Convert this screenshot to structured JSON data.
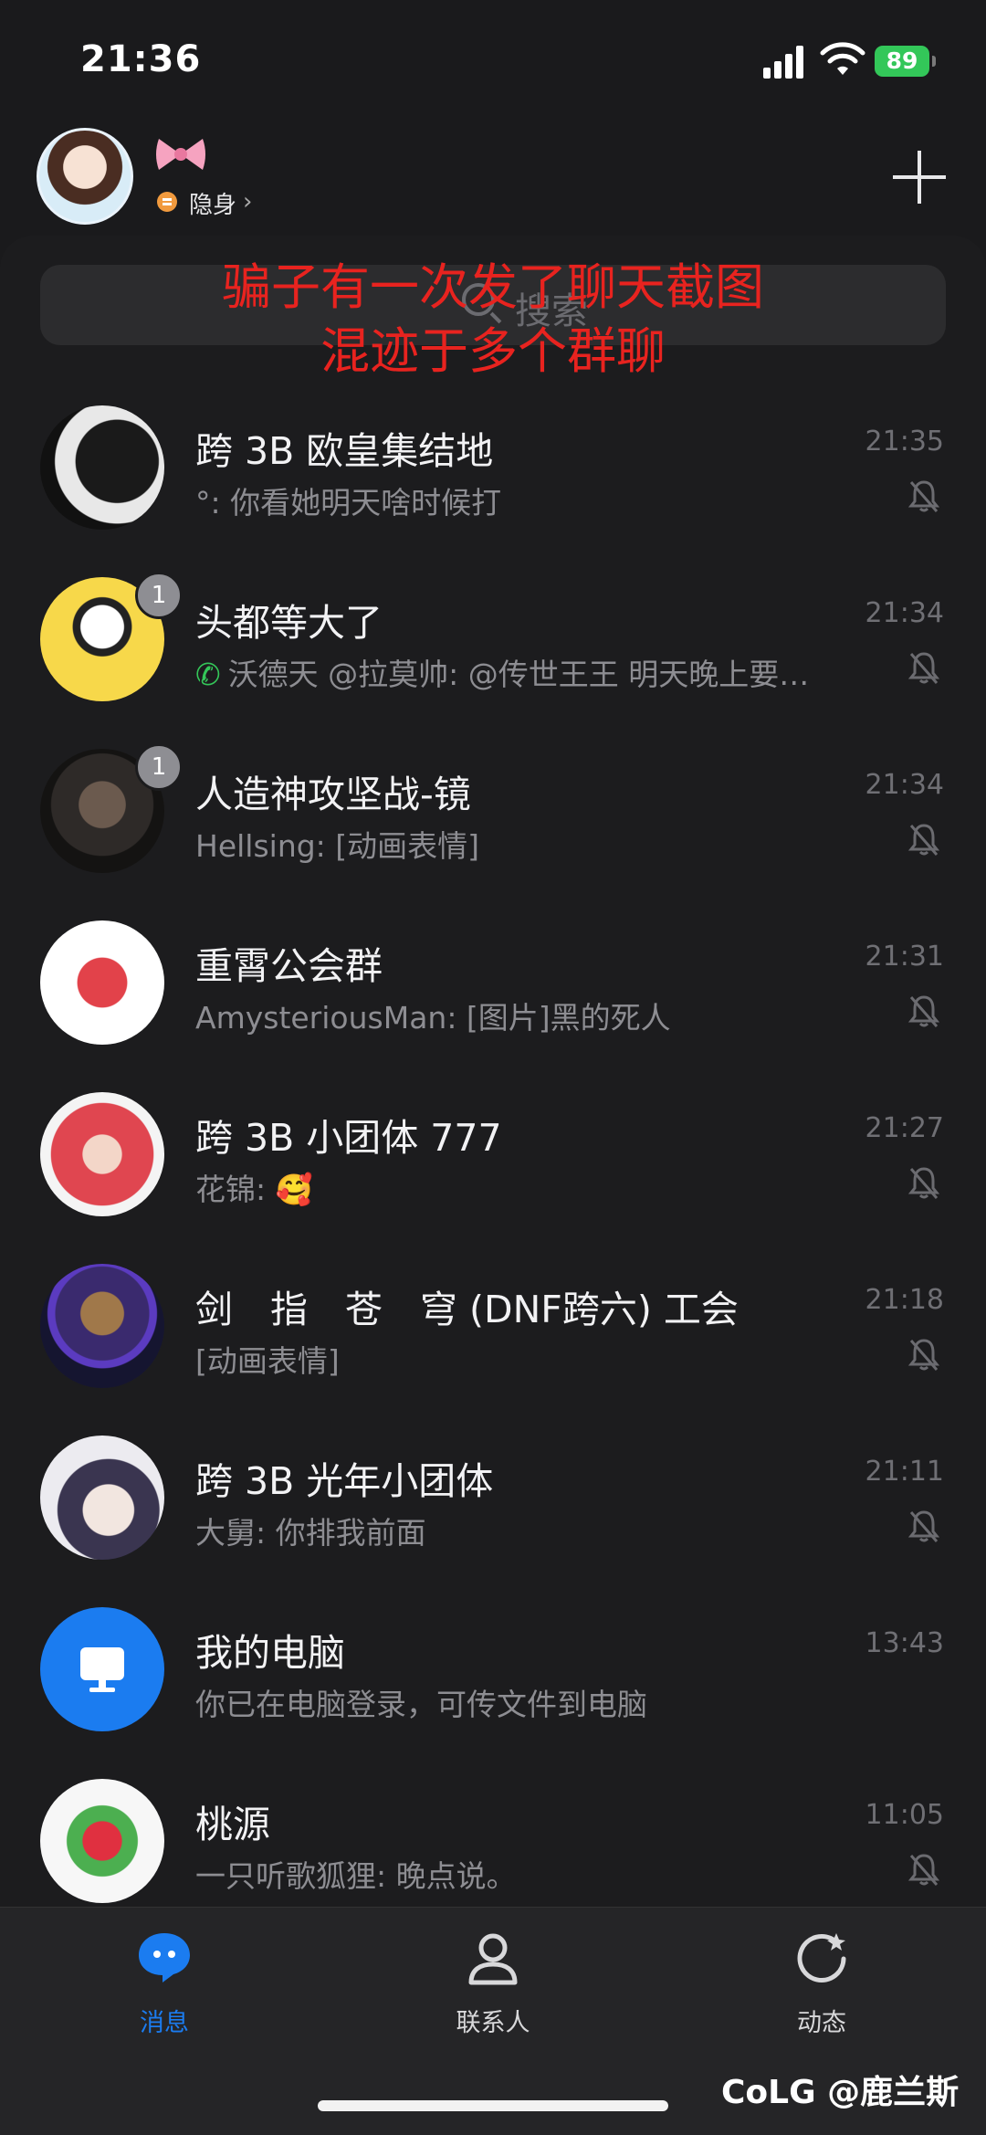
{
  "status_bar": {
    "time": "21:36",
    "battery": "89"
  },
  "header": {
    "status_label": "隐身",
    "status_chevron": "›"
  },
  "search": {
    "placeholder": "搜索"
  },
  "overlay": {
    "line1": "骗子有一次发了聊天截图",
    "line2": "混迹于多个群聊"
  },
  "chats": [
    {
      "name": "跨 3B 欧皇集结地",
      "preview": "°: 你看她明天啥时候打",
      "time": "21:35",
      "badge": "",
      "muted": true
    },
    {
      "name": "头都等大了",
      "preview": "沃德天 @拉莫帅: @传世王王 明天晚上要…",
      "time": "21:34",
      "badge": "1",
      "muted": true,
      "call_icon": "phone-icon"
    },
    {
      "name": "人造神攻坚战-镜",
      "preview": "Hellsing: [动画表情]",
      "time": "21:34",
      "badge": "1",
      "muted": true
    },
    {
      "name": "重霄公会群",
      "preview": "AmysteriousMan: [图片]黑的死人",
      "time": "21:31",
      "badge": "",
      "muted": true
    },
    {
      "name": "跨 3B 小团体 777",
      "preview": "花锦: 🥰",
      "time": "21:27",
      "badge": "",
      "muted": true
    },
    {
      "name": "剑　指　苍　穹 (DNF跨六) 工会",
      "preview": "[动画表情]",
      "time": "21:18",
      "badge": "",
      "muted": true
    },
    {
      "name": "跨 3B 光年小团体",
      "preview": "大舅: 你排我前面",
      "time": "21:11",
      "badge": "",
      "muted": true
    },
    {
      "name": "我的电脑",
      "preview": "你已在电脑登录，可传文件到电脑",
      "time": "13:43",
      "badge": "",
      "muted": false
    },
    {
      "name": "桃源",
      "preview": "一只听歌狐狸: 晚点说。",
      "time": "11:05",
      "badge": "",
      "muted": true
    }
  ],
  "tabs": [
    {
      "label": "消息",
      "icon": "chat-bubble-icon",
      "active": true
    },
    {
      "label": "联系人",
      "icon": "person-icon",
      "active": false
    },
    {
      "label": "动态",
      "icon": "refresh-star-icon",
      "active": false
    }
  ],
  "watermark": "CoLG @鹿兰斯",
  "colors": {
    "accent": "#1b7cf0",
    "overlay_text": "#e8231f",
    "battery": "#33c759",
    "background": "#1c1c1e"
  }
}
